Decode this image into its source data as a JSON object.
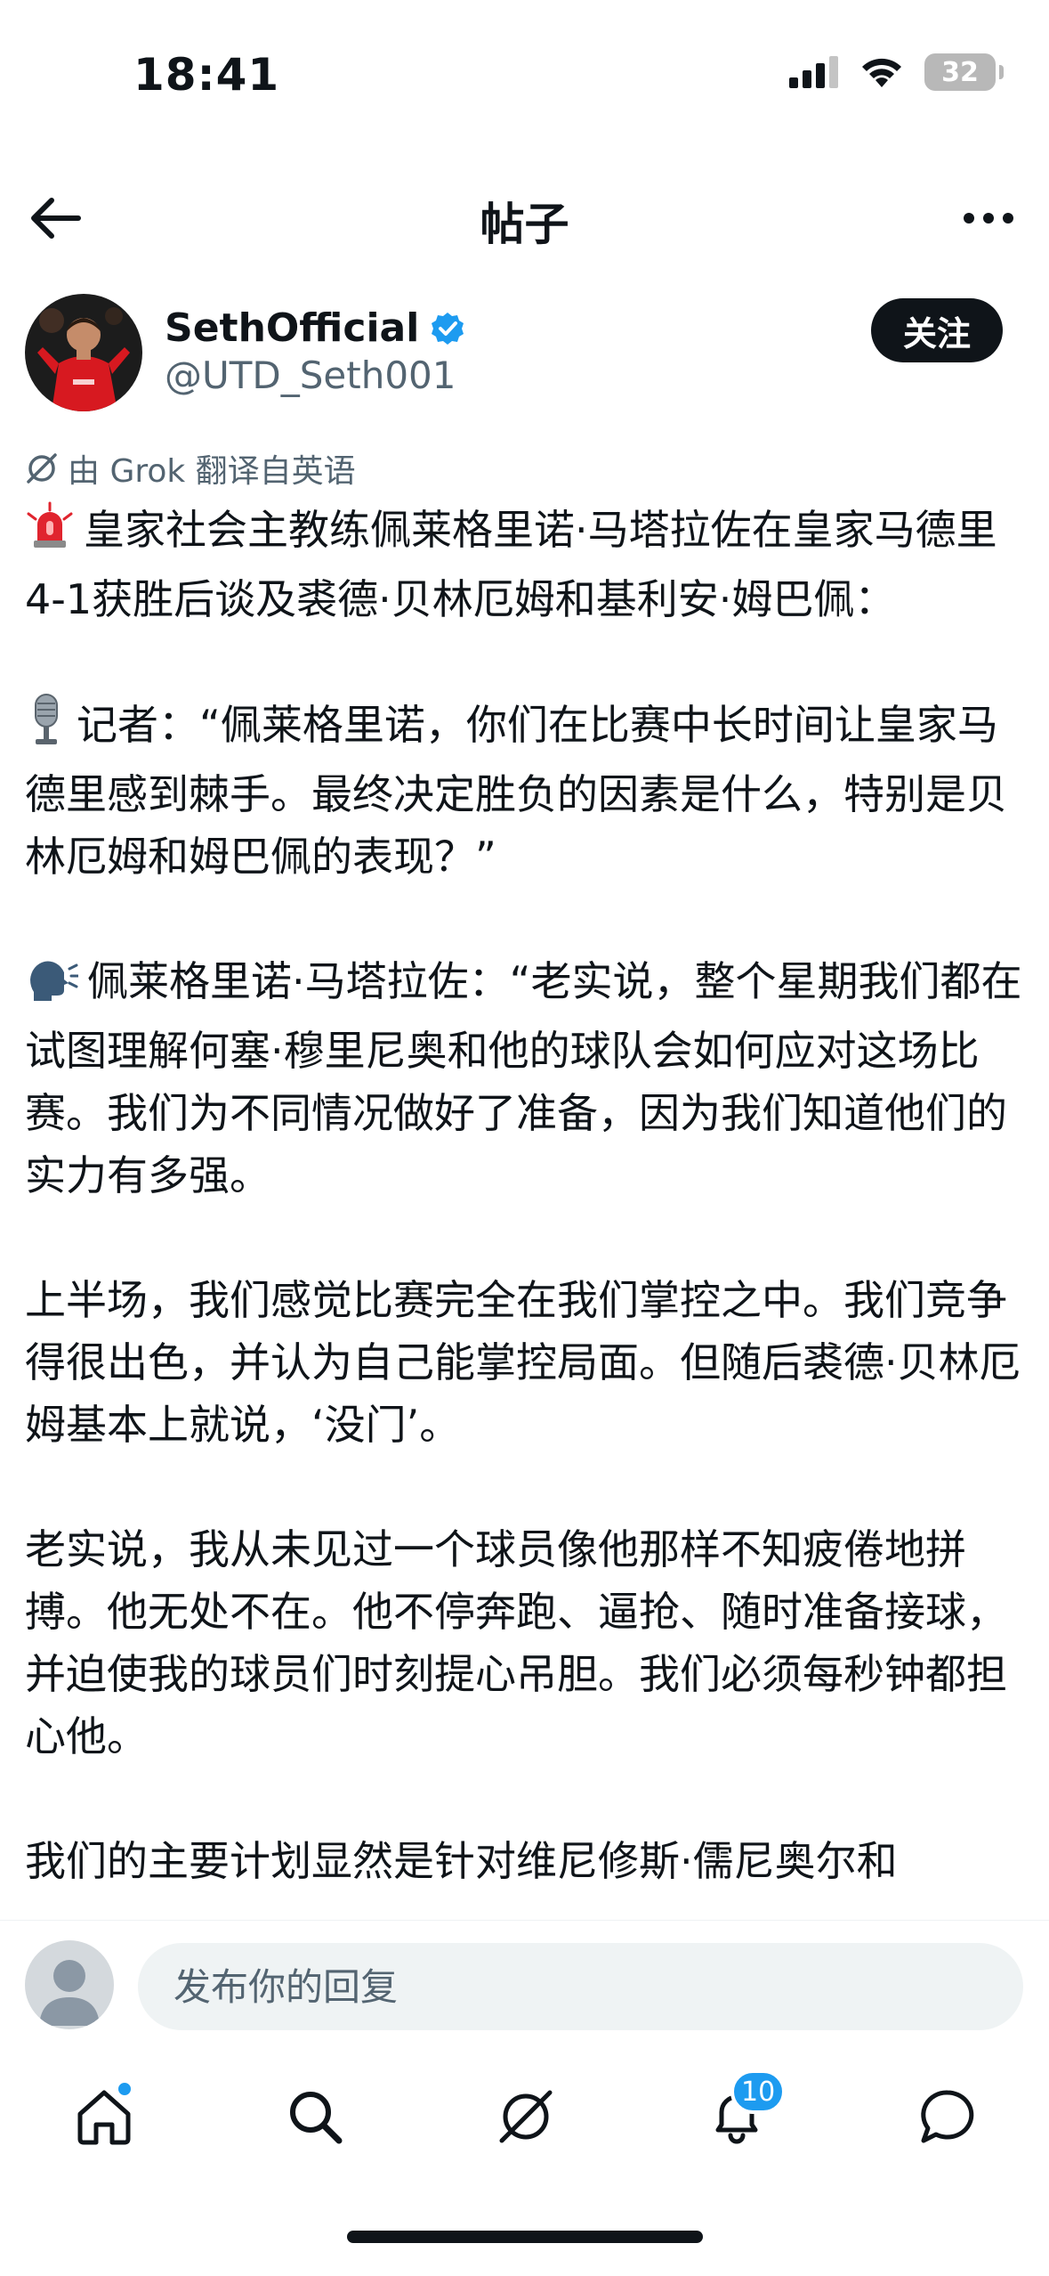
{
  "status": {
    "time": "18:41",
    "battery": "32"
  },
  "header": {
    "title": "帖子"
  },
  "author": {
    "display_name": "SethOfficial",
    "handle": "@UTD_Seth001",
    "follow_label": "关注"
  },
  "translation_note": "由 Grok 翻译自英语",
  "tweet": {
    "p1": "皇家社会主教练佩莱格里诺·马塔拉佐在皇家马德里4-1获胜后谈及裘德·贝林厄姆和基利安·姆巴佩：",
    "p2": "记者：“佩莱格里诺，你们在比赛中长时间让皇家马德里感到棘手。最终决定胜负的因素是什么，特别是贝林厄姆和姆巴佩的表现？”",
    "p3": "佩莱格里诺·马塔拉佐：“老实说，整个星期我们都在试图理解何塞·穆里尼奥和他的球队会如何应对这场比赛。我们为不同情况做好了准备，因为我们知道他们的实力有多强。",
    "p4": "上半场，我们感觉比赛完全在我们掌控之中。我们竞争得很出色，并认为自己能掌控局面。但随后裘德·贝林厄姆基本上就说，‘没门’。",
    "p5": "老实说，我从未见过一个球员像他那样不知疲倦地拼搏。他无处不在。他不停奔跑、逼抢、随时准备接球，并迫使我的球员们时刻提心吊胆。我们必须每秒钟都担心他。",
    "p6": "我们的主要计划显然是针对维尼修斯·儒尼奥尔和"
  },
  "reply": {
    "placeholder": "发布你的回复"
  },
  "tabs": {
    "notifications_badge": "10"
  },
  "icons": {
    "back": "arrow-left-icon",
    "more": "more-horizontal-icon",
    "verified": "verified-badge-icon",
    "translate": "grok-icon",
    "siren": "siren-emoji",
    "microphone": "microphone-emoji",
    "speaking": "speaking-head-emoji",
    "home": "home-icon",
    "search": "search-icon",
    "grok": "grok-icon",
    "notifications": "bell-icon",
    "messages": "message-icon"
  },
  "colors": {
    "accent": "#1d9bf0",
    "text": "#0f1419",
    "muted": "#536471"
  }
}
